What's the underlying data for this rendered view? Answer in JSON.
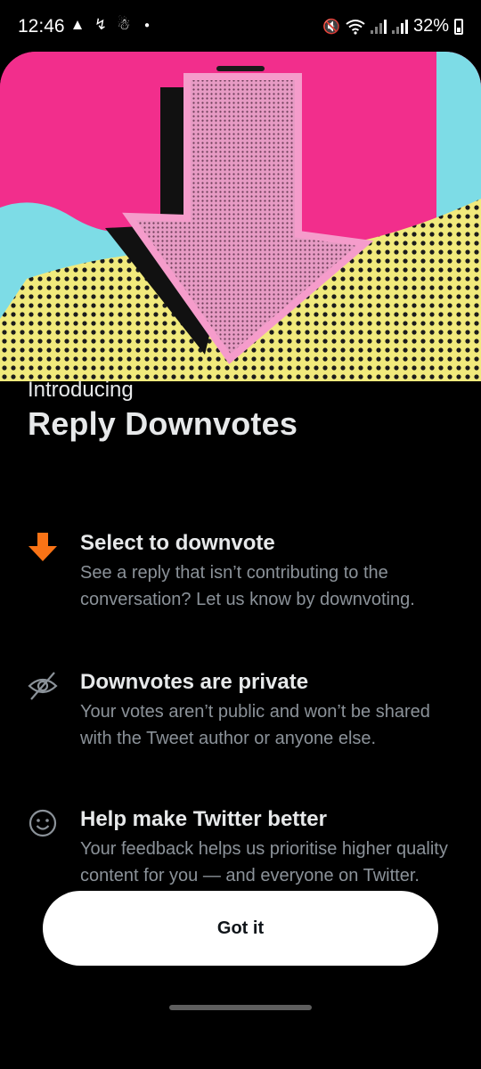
{
  "status_bar": {
    "time": "12:46",
    "battery": "32%",
    "icons": [
      "alert-icon",
      "missed-call-icon",
      "app-notification-icon",
      "dot-icon",
      "mute-icon",
      "wifi-icon",
      "signal-icon",
      "signal-icon",
      "battery-icon"
    ]
  },
  "sheet": {
    "kicker": "Introducing",
    "title": "Reply Downvotes",
    "features": [
      {
        "icon": "downvote-arrow-icon",
        "icon_color": "#f97316",
        "title": "Select to downvote",
        "description": "See a reply that isn’t contributing to the conversation? Let us know by downvoting."
      },
      {
        "icon": "eye-off-icon",
        "title": "Downvotes are private",
        "description": "Your votes aren’t public and won’t be shared with the Tweet author or anyone else."
      },
      {
        "icon": "smiley-icon",
        "title": "Help make Twitter better",
        "description": "Your feedback helps us prioritise higher quality content for you — and everyone on Twitter."
      }
    ],
    "button_label": "Got it"
  },
  "colors": {
    "hero_pink": "#f22e8c",
    "hero_cyan": "#7ddce6",
    "hero_yellow": "#f1ea7c",
    "arrow_pink": "#f59ccb",
    "accent_orange": "#f97316",
    "muted_text": "#8b9299"
  }
}
